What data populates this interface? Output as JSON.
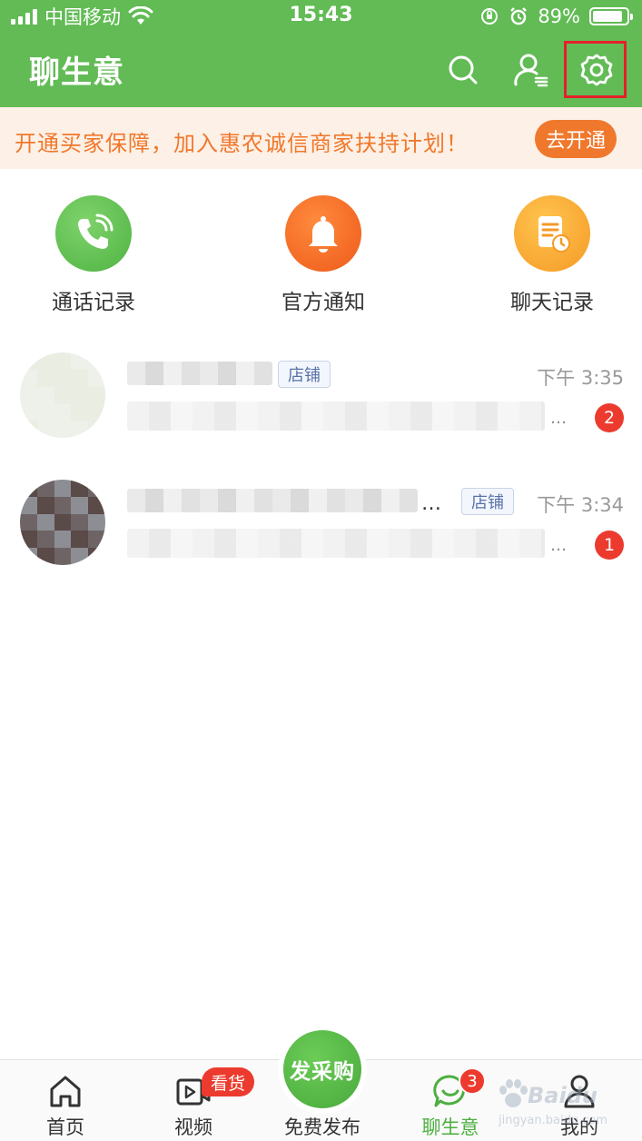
{
  "status_bar": {
    "carrier": "中国移动",
    "time": "15:43",
    "battery": "89%",
    "battery_level": 0.89
  },
  "header": {
    "title": "聊生意",
    "icons": [
      "search-icon",
      "contacts-icon",
      "settings-icon"
    ]
  },
  "promo": {
    "text": "开通买家保障，加入惠农诚信商家扶持计划！",
    "button": "去开通"
  },
  "quick_actions": [
    {
      "label": "通话记录",
      "icon": "phone-icon",
      "color": "#4fb343"
    },
    {
      "label": "官方通知",
      "icon": "bell-icon",
      "color": "#ee5a1a"
    },
    {
      "label": "聊天记录",
      "icon": "document-clock-icon",
      "color": "#f59a25"
    }
  ],
  "conversations": [
    {
      "tag": "店铺",
      "time": "下午 3:35",
      "unread": "2",
      "ellipsis": "…"
    },
    {
      "tag": "店铺",
      "time": "下午 3:34",
      "unread": "1",
      "ellipsis": "…",
      "name_ellipsis": "…"
    }
  ],
  "tabbar": {
    "home": "首页",
    "video": "视频",
    "video_badge": "看货",
    "publish_button": "发采购",
    "publish": "免费发布",
    "chat": "聊生意",
    "chat_badge": "3",
    "mine": "我的"
  },
  "watermark": {
    "text": "Baidu",
    "url": "jingyan.baidu.com"
  },
  "colors": {
    "brand_green": "#62bb55",
    "accent_orange": "#f0782c",
    "badge_red": "#ec3b2e",
    "highlight_red": "#e5202a"
  }
}
